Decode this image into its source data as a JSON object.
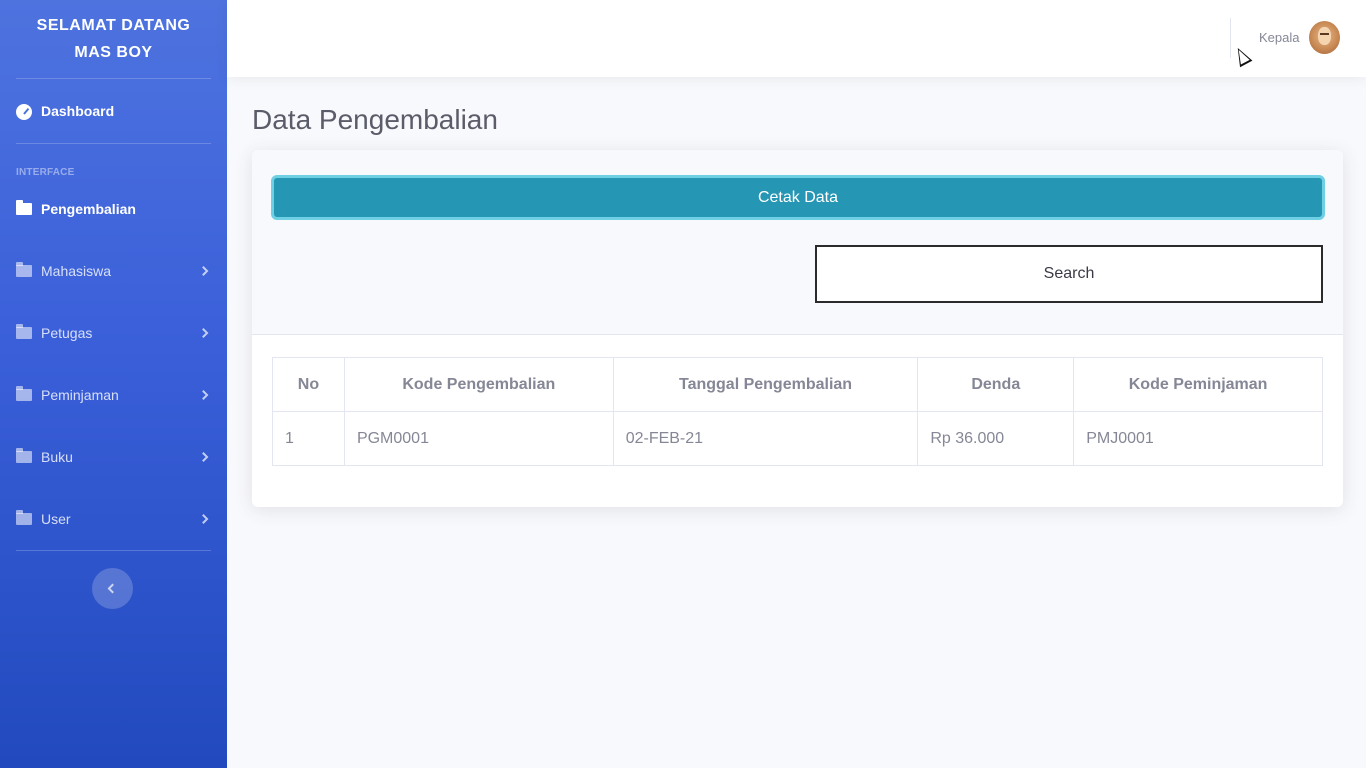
{
  "sidebar": {
    "brand_line1": "SELAMAT DATANG",
    "brand_line2": "MAS BOY",
    "dashboard_label": "Dashboard",
    "section_heading": "INTERFACE",
    "items": [
      {
        "label": "Pengembalian",
        "active": true
      },
      {
        "label": "Mahasiswa"
      },
      {
        "label": "Petugas"
      },
      {
        "label": "Peminjaman"
      },
      {
        "label": "Buku"
      },
      {
        "label": "User"
      }
    ]
  },
  "topbar": {
    "user_name": "Kepala"
  },
  "main": {
    "page_title": "Data Pengembalian",
    "print_button": "Cetak Data",
    "search_label": "Search",
    "table": {
      "headers": [
        "No",
        "Kode Pengembalian",
        "Tanggal Pengembalian",
        "Denda",
        "Kode Peminjaman"
      ],
      "rows": [
        [
          "1",
          "PGM0001",
          "02-FEB-21",
          "Rp 36.000",
          "PMJ0001"
        ]
      ]
    }
  },
  "colors": {
    "sidebar_gradient_top": "#4e73df",
    "sidebar_gradient_bottom": "#224abe",
    "print_button": "#2596b3",
    "print_button_border": "#6fd0e4",
    "text_muted": "#858796"
  }
}
